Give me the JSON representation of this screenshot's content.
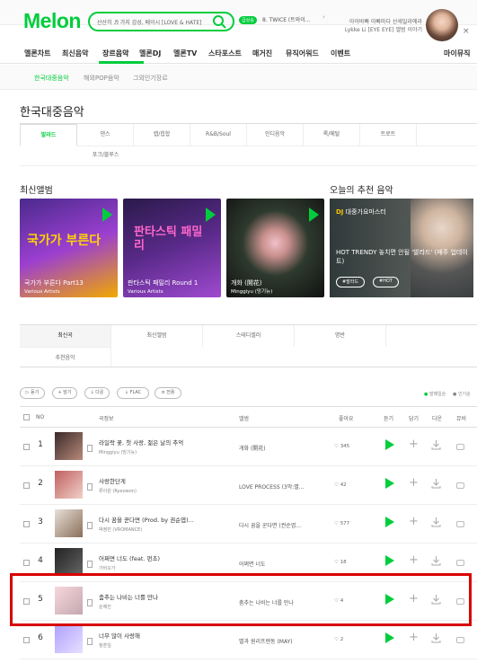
{
  "header": {
    "logo": "Melon",
    "search_value": "산산히 ♬ 가지 감성, 베이시 [LOVE & HATE]",
    "live_badge": "급상승",
    "live_text": "8. TWICE (트와이...",
    "arrow": "›",
    "promo_line1": "아이바빠 아빠마다 산세일라에라",
    "promo_line2": "Lykke Li [EYE EYE] 앨범 이야기",
    "close": "×"
  },
  "gnb": [
    "멜론차트",
    "최신음악",
    "장르음악",
    "멜론DJ",
    "멜론TV",
    "스타포스트",
    "매거진",
    "뮤직어워드",
    "이벤트",
    "마이뮤직"
  ],
  "subnav": [
    "한국대중음악",
    "해외POP음악",
    "그외인기장르"
  ],
  "page_title": "한국대중음악",
  "genre_tabs": [
    "발라드",
    "댄스",
    "랩/힙합",
    "R&B/Soul",
    "인디음악",
    "록/메탈",
    "트로트",
    "포크/블루스"
  ],
  "sections": {
    "new_album": "최신앨범",
    "recommend": "오늘의 추천 음악"
  },
  "albums": [
    {
      "title": "국가가 부른다 Part13",
      "artist": "Various Artists",
      "art": "국가가 부른다"
    },
    {
      "title": "판타스틱 패밀리 Round 1",
      "artist": "Various Artists",
      "art": "판타스틱 패밀리"
    },
    {
      "title": "개화 (開花)",
      "artist": "Minggi​yu (밍기뉴)",
      "art": ""
    }
  ],
  "recommend": {
    "tag_dj": "DJ",
    "tag": "대중가요마스터",
    "text": "HOT TRENDY 놓치면 안될 '발라드' (매주 업데이트)",
    "btn1": "#발라드",
    "btn2": "#HOT"
  },
  "list_tabs": [
    "최신곡",
    "최신앨범",
    "스테디셀러",
    "명반",
    "추천음악"
  ],
  "filters": [
    "듣기",
    "담기",
    "다운",
    "FLAC",
    "전용"
  ],
  "sort": {
    "popular": "발매일순",
    "recent": "인기순"
  },
  "table_head": {
    "no": "NO",
    "song": "곡정보",
    "album": "앨범",
    "like": "좋아요",
    "listen": "듣기",
    "add": "담기",
    "down": "다운",
    "mv": "뮤비"
  },
  "songs": [
    {
      "rank": "1",
      "title": "라일락 꽃, 첫 사랑, 젊은 날의 추억",
      "artist": "Minggiyu (밍기뉴)",
      "album": "개화 (開花)",
      "likes": "345"
    },
    {
      "rank": "2",
      "title": "사랑한단게",
      "artist": "류이원 (Ryeowon)",
      "album": "LOVE PROCESS (3막:별...",
      "likes": "42"
    },
    {
      "rank": "3",
      "title": "다시 꿈을 꾼다면 (Prod. by 권순엽)...",
      "artist": "박정민 (VROMANCE)",
      "album": "다시 꿈을 꾼다면 (권순엽...",
      "likes": "577"
    },
    {
      "rank": "4",
      "title": "어쩌면 너도 (feat. 펀초)",
      "artist": "가비오가",
      "album": "어쩌면 너도",
      "likes": "18"
    },
    {
      "rank": "5",
      "title": "춤추는 나비는 너를 만나",
      "artist": "순예진",
      "album": "춤추는 나비는 너를 만나",
      "likes": "4"
    },
    {
      "rank": "6",
      "title": "너무 많이 사랑해",
      "artist": "정훈일",
      "album": "별과 원리프렌동 (MAY)",
      "likes": "2"
    }
  ],
  "colors": {
    "accent": "#00cd3c",
    "highlight": "#d90000"
  }
}
